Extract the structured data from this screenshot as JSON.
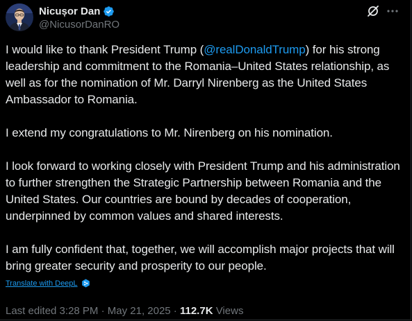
{
  "author": {
    "display_name": "Nicușor Dan",
    "handle": "@NicusorDanRO"
  },
  "post": {
    "paragraph_1_before": "I would like to thank President Trump (",
    "mention": "@realDonaldTrump",
    "paragraph_1_after": ") for his strong leadership and commitment to the Romania–United States relationship, as well as for the nomination of Mr. Darryl Nirenberg as the United States Ambassador to Romania.",
    "paragraph_2": "I extend my congratulations to Mr. Nirenberg on his nomination.",
    "paragraph_3": "I look forward to working closely with President Trump and his administration to further strengthen the Strategic Partnership between Romania and the United States. Our countries are bound by decades of cooperation, underpinned by common values and shared interests.",
    "paragraph_4": "I am fully confident that, together, we will accomplish major projects that will bring greater security and prosperity to our people."
  },
  "translate": {
    "label": "Translate with DeepL"
  },
  "meta": {
    "edited": "Last edited 3:28 PM · May 21, 2025 · ",
    "views_count": "112.7K",
    "views_label": " Views"
  },
  "colors": {
    "background": "#000000",
    "text": "#e7e9ea",
    "secondary": "#71767b",
    "accent": "#1d9bf0"
  },
  "icons": [
    "avatar",
    "verified-badge-icon",
    "grok-icon",
    "more-icon",
    "deepl-icon"
  ]
}
